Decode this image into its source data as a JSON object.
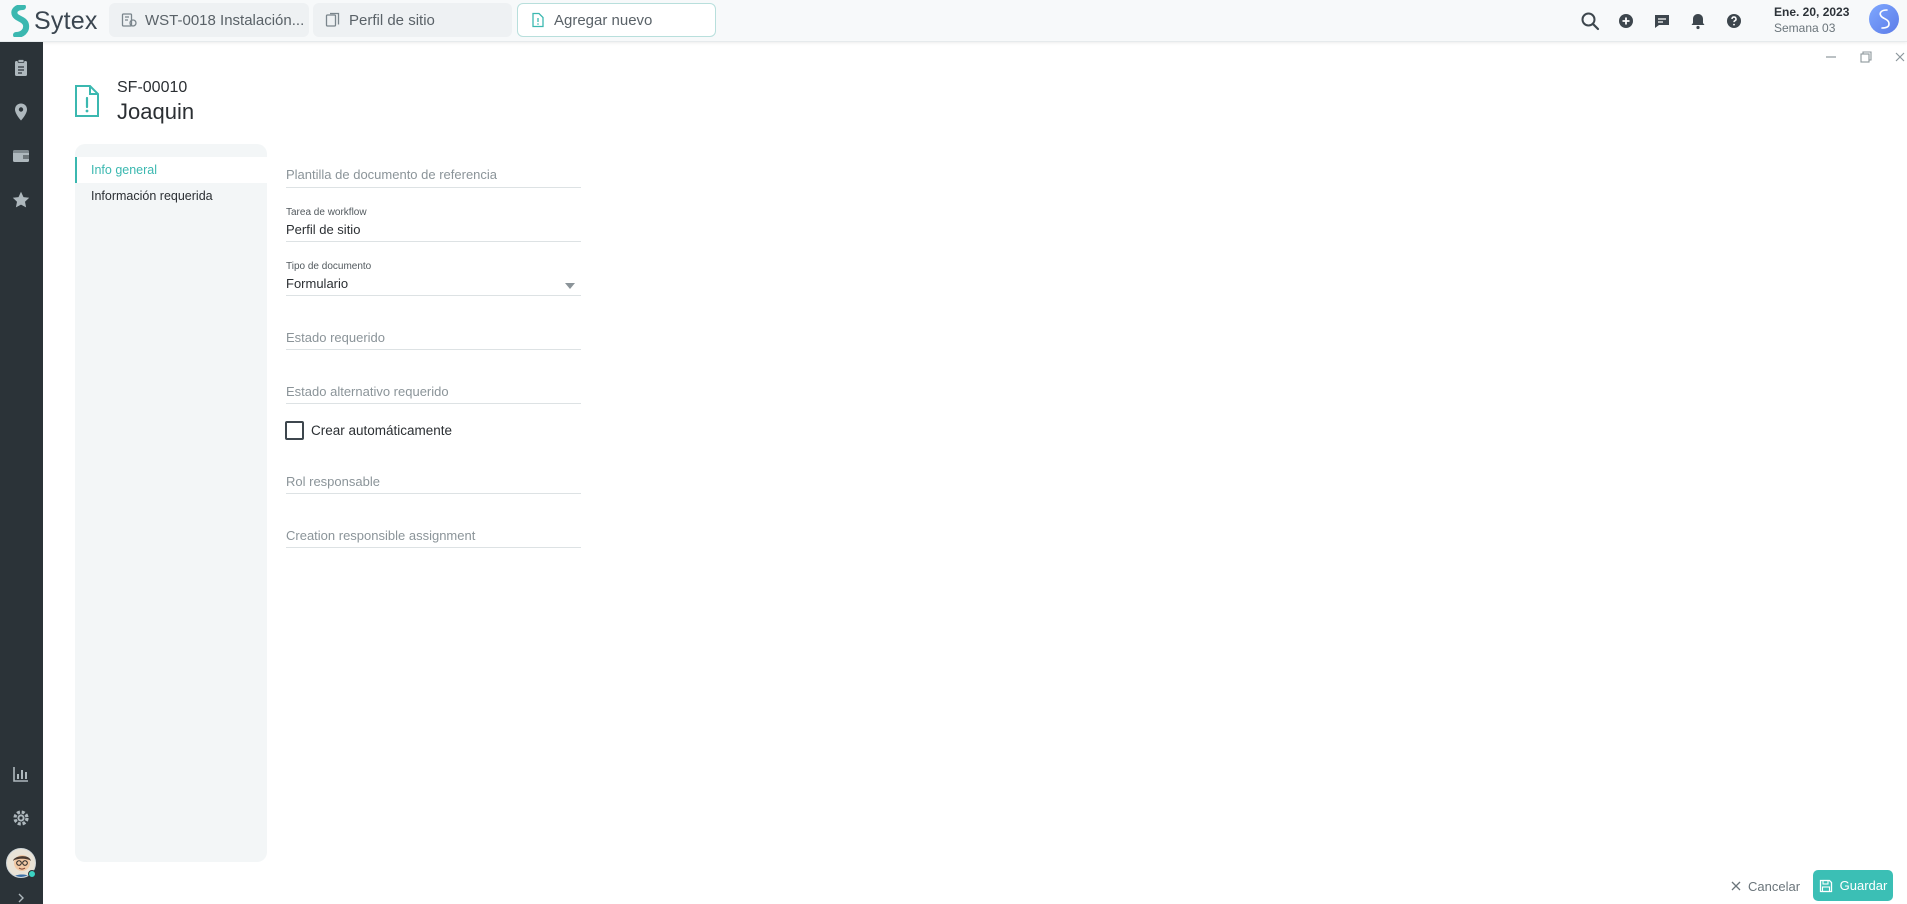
{
  "app": {
    "brand": "Sytex"
  },
  "tabs": [
    {
      "label": "WST-0018 Instalación..."
    },
    {
      "label": "Perfil de sitio"
    },
    {
      "label": "Agregar nuevo"
    }
  ],
  "header": {
    "date": "Ene. 20, 2023",
    "week": "Semana 03"
  },
  "document": {
    "code": "SF-00010",
    "title": "Joaquin"
  },
  "nav": [
    {
      "label": "Info general"
    },
    {
      "label": "Información requerida"
    }
  ],
  "form": {
    "reference_template": {
      "placeholder": "Plantilla de documento de referencia"
    },
    "workflow_task": {
      "label": "Tarea de workflow",
      "value": "Perfil de sitio"
    },
    "document_type": {
      "label": "Tipo de documento",
      "value": "Formulario"
    },
    "required_state": {
      "placeholder": "Estado requerido"
    },
    "alt_required_state": {
      "placeholder": "Estado alternativo requerido"
    },
    "auto_create": {
      "label": "Crear automáticamente",
      "checked": false
    },
    "responsible_role": {
      "placeholder": "Rol responsable"
    },
    "creation_assignment": {
      "placeholder": "Creation responsible assignment"
    }
  },
  "footer": {
    "cancel_label": "Cancelar",
    "save_label": "Guardar"
  },
  "colors": {
    "accent": "#3bbfb5",
    "sidebar": "#2b3338",
    "text": "#2b2f33"
  }
}
